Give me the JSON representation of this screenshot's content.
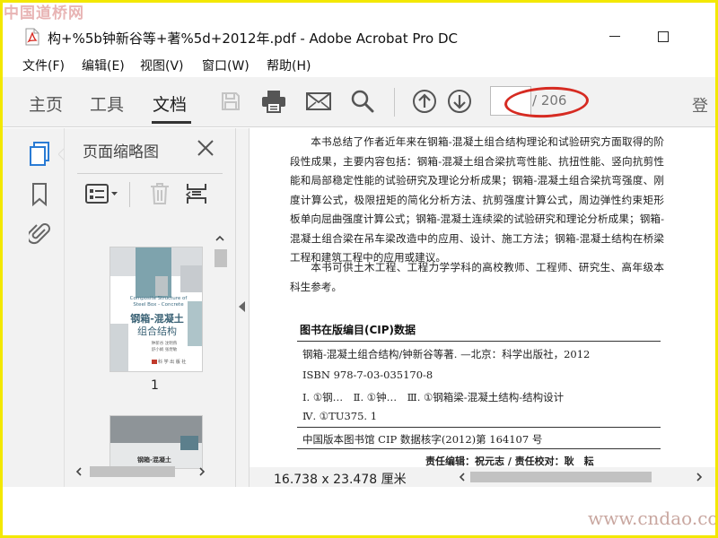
{
  "watermarks": {
    "top": "中国道桥网",
    "bottom": "www.cndao.com"
  },
  "window": {
    "title": "构+%5b钟新谷等+著%5d+2012年.pdf - Adobe Acrobat Pro DC",
    "app_icon": "pdf-file-icon"
  },
  "menu": [
    "文件(F)",
    "编辑(E)",
    "视图(V)",
    "窗口(W)",
    "帮助(H)"
  ],
  "toolbar": {
    "tabs": [
      {
        "label": "主页"
      },
      {
        "label": "工具"
      },
      {
        "label": "文档",
        "active": true
      }
    ],
    "icons": [
      "save-icon",
      "print-icon",
      "email-icon",
      "search-icon",
      "page-up-icon",
      "page-down-icon"
    ],
    "page_current": "",
    "page_total": "/ 206",
    "login_label": "登"
  },
  "thumbnail_panel": {
    "title": "页面缩略图",
    "page_label": "1",
    "cover": {
      "en_title": "Composite Structure of Steel Box - Concrete",
      "cn_title_1": "钢箱-混凝土",
      "cn_title_2": "组合结构",
      "authors_1": "钟新谷 沈明燕",
      "authors_2": "舒小娟 张煜敏",
      "publisher": "科 学 出 版 社"
    },
    "cover2": {
      "cn_title_1": "钢箱-混凝土"
    }
  },
  "document": {
    "paragraph_1": "本书总结了作者近年来在钢箱-混凝土组合结构理论和试验研究方面取得的阶段性成果，主要内容包括：钢箱-混凝土组合梁抗弯性能、抗扭性能、竖向抗剪性能和局部稳定性能的试验研究及理论分析成果；钢箱-混凝土组合梁抗弯强度、刚度计算公式，极限扭矩的简化分析方法、抗剪强度计算公式，周边弹性约束矩形板单向屈曲强度计算公式；钢箱-混凝土连续梁的试验研究和理论分析成果；钢箱-混凝土组合梁在吊车梁改造中的应用、设计、施工方法；钢箱-混凝土结构在桥梁工程和建筑工程中的应用或建议。",
    "paragraph_2": "本书可供土木工程、工程力学学科的高校教师、工程师、研究生、高年级本科生参考。",
    "cip_title": "图书在版编目(CIP)数据",
    "cip_line_1": "钢箱-混凝土组合结构/钟新谷等著. —北京：科学出版社，2012",
    "cip_line_2": "ISBN 978-7-03-035170-8",
    "cip_line_3": "Ⅰ. ①钢…　Ⅱ. ①钟…　Ⅲ. ①钢箱梁-混凝土结构-结构设计",
    "cip_line_4": "Ⅳ. ①TU375. 1",
    "cip_line_5": "中国版本图书馆 CIP 数据核字(2012)第 164107 号",
    "credits": "责任编辑：祝元志 / 责任校对：耿　耘"
  },
  "status": {
    "page_size": "16.738 x 23.478 厘米"
  },
  "colors": {
    "accent_blue": "#2a7bd4",
    "annotation_red": "#d62b22",
    "frame_yellow": "#f3e800"
  }
}
